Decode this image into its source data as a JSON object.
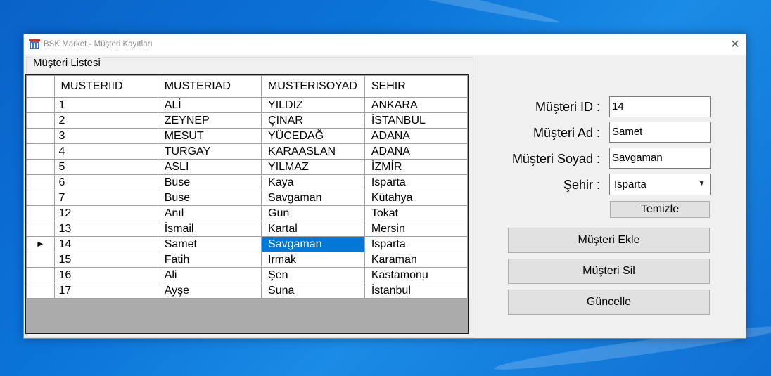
{
  "window": {
    "title": "BSK Market - Müşteri Kayıtları",
    "close_glyph": "✕"
  },
  "group": {
    "label": "Müşteri Listesi"
  },
  "grid": {
    "columns": [
      "MUSTERIID",
      "MUSTERIAD",
      "MUSTERISOYAD",
      "SEHIR"
    ],
    "current_row_marker": "▶",
    "rows": [
      [
        "1",
        "ALİ",
        "YILDIZ",
        "ANKARA"
      ],
      [
        "2",
        "ZEYNEP",
        "ÇINAR",
        "İSTANBUL"
      ],
      [
        "3",
        "MESUT",
        "YÜCEDAĞ",
        "ADANA"
      ],
      [
        "4",
        "TURGAY",
        "KARAASLAN",
        "ADANA"
      ],
      [
        "5",
        "ASLI",
        "YILMAZ",
        "İZMİR"
      ],
      [
        "6",
        "Buse",
        "Kaya",
        " Isparta"
      ],
      [
        "7",
        "Buse",
        "Savgaman",
        " Kütahya"
      ],
      [
        "12",
        "Anıl",
        "Gün",
        " Tokat"
      ],
      [
        "13",
        "İsmail",
        "Kartal",
        " Mersin"
      ],
      [
        "14",
        "Samet",
        "Savgaman",
        " Isparta"
      ],
      [
        "15",
        "Fatih",
        "Irmak",
        " Karaman"
      ],
      [
        "16",
        "Ali",
        "Şen",
        " Kastamonu"
      ],
      [
        "17",
        "Ayşe",
        "Suna",
        " İstanbul"
      ]
    ]
  },
  "form": {
    "id_label": "Müşteri ID :",
    "id_value": "14",
    "ad_label": "Müşteri Ad :",
    "ad_value": "Samet",
    "soyad_label": "Müşteri Soyad :",
    "soyad_value": "Savgaman",
    "sehir_label": "Şehir :",
    "sehir_value": "Isparta",
    "temizle": "Temizle",
    "ekle": "Müşteri Ekle",
    "sil": "Müşteri Sil",
    "guncelle": "Güncelle"
  },
  "selection": {
    "row": 9,
    "column": 2
  },
  "colors": {
    "selection": "#0078d7",
    "grid_background": "#ababab"
  },
  "icons": {
    "app": "market-building-icon",
    "close": "close-icon",
    "dropdown": "chevron-down-icon",
    "row_pointer": "current-row-arrow-icon"
  }
}
